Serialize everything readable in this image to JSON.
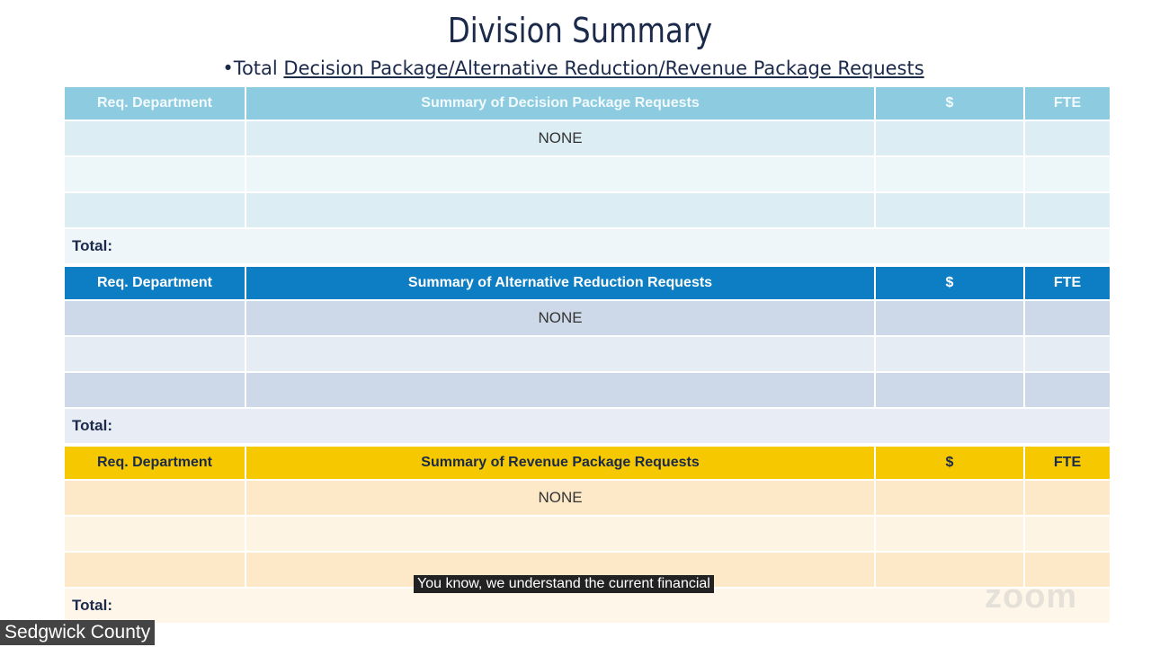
{
  "slide": {
    "title": "Division Summary",
    "subtitle_prefix": "•Total ",
    "subtitle_link": "Decision Package/Alternative Reduction/Revenue Package Requests"
  },
  "tables": [
    {
      "headers": [
        "Req. Department",
        "Summary of Decision Package Requests",
        "$",
        "FTE"
      ],
      "first_row": "NONE",
      "total_label": "Total:"
    },
    {
      "headers": [
        "Req. Department",
        "Summary of Alternative Reduction Requests",
        "$",
        "FTE"
      ],
      "first_row": "NONE",
      "total_label": "Total:"
    },
    {
      "headers": [
        "Req. Department",
        "Summary of Revenue Package Requests",
        "$",
        "FTE"
      ],
      "first_row": "NONE",
      "total_label": "Total:"
    }
  ],
  "caption": "You know, we understand the current financial",
  "participant": "Sedgwick County",
  "watermark": "zoom"
}
